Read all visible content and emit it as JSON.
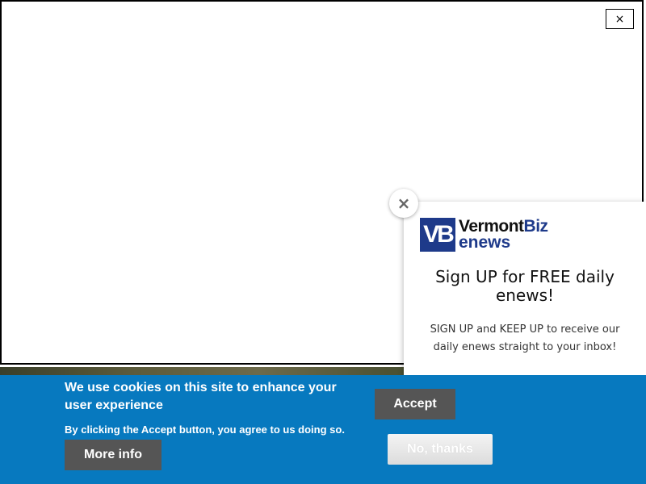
{
  "modal": {
    "close_label": "×"
  },
  "newsletter": {
    "close_label": "×",
    "logo_mark": "VB",
    "logo_word1": "Vermont",
    "logo_word2": "Biz",
    "logo_subtitle": "enews",
    "heading": "Sign UP for FREE daily enews!",
    "body": "SIGN UP and KEEP UP to receive our daily enews straight to your inbox!",
    "brand_color": "#1e3a8a"
  },
  "cookie": {
    "title": "We use cookies on this site to enhance your user experience",
    "text": "By clicking the Accept button, you agree to us doing so.",
    "more_info_label": "More info",
    "accept_label": "Accept",
    "decline_label": "No, thanks",
    "banner_color": "#0779bf",
    "button_color": "#555555"
  }
}
